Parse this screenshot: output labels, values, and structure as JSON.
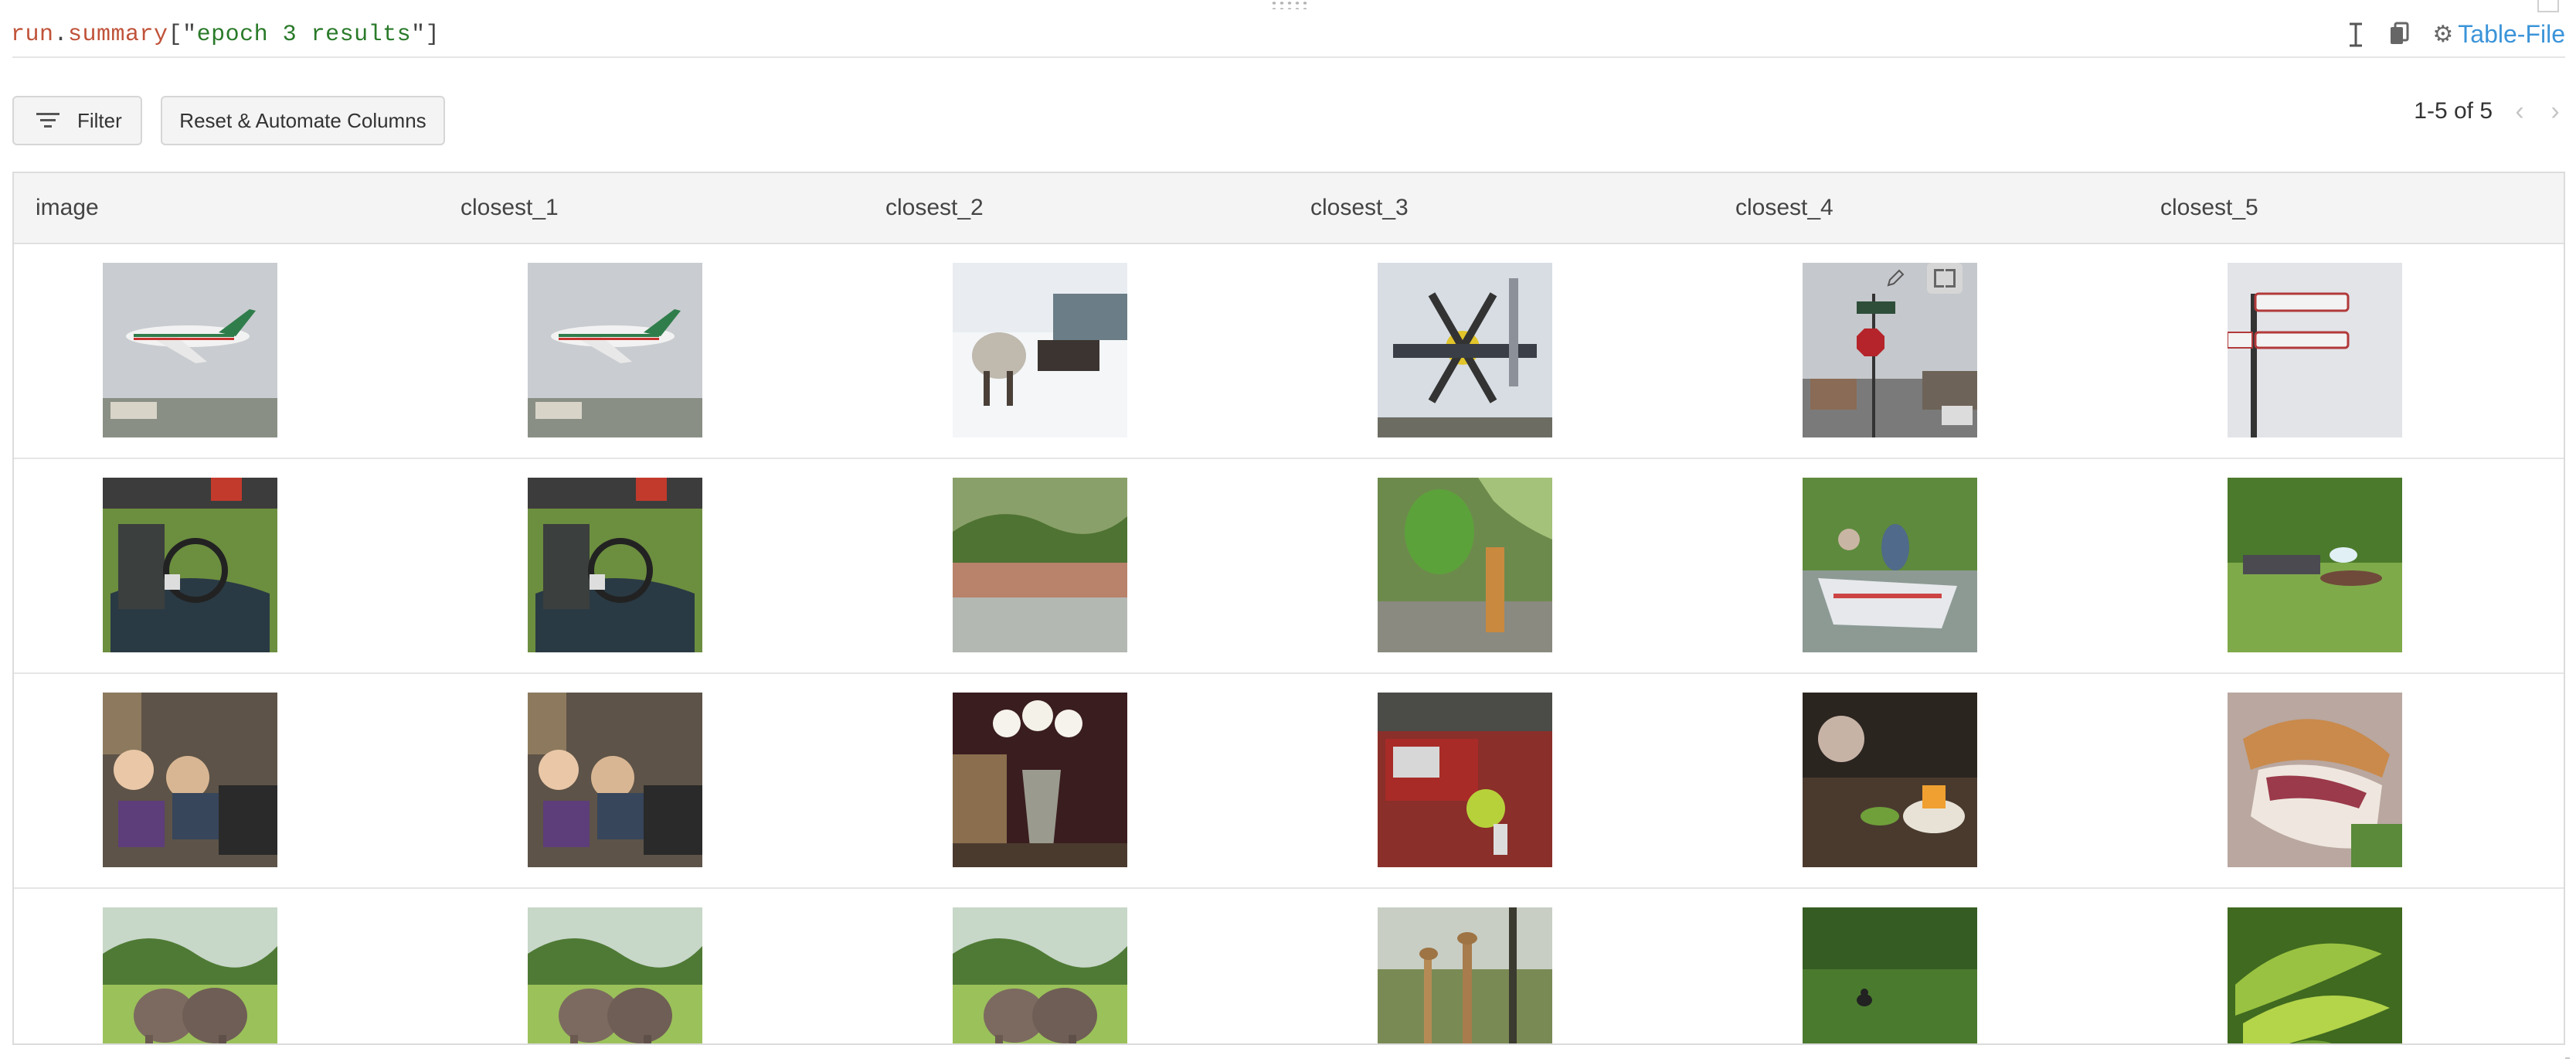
{
  "expression": {
    "obj": "run",
    "dot": ".",
    "attr": "summary",
    "open": "[\"",
    "key": "epoch 3 results",
    "close": "\"]"
  },
  "toolbar": {
    "type_label": "Table-File",
    "accent": "#3b94d9"
  },
  "controls": {
    "filter_label": "Filter",
    "reset_label": "Reset & Automate Columns"
  },
  "pagination": {
    "range_text": "1-5 of 5"
  },
  "table": {
    "columns": [
      "image",
      "closest_1",
      "closest_2",
      "closest_3",
      "closest_4",
      "closest_5"
    ],
    "rows": [
      [
        "airliner",
        "airliner",
        "horse-in-snow",
        "propeller-plane",
        "street-sign-stop",
        "street-sign-pole"
      ],
      [
        "vintage-race-car",
        "vintage-race-car",
        "river-palm-trees",
        "banana-bunch",
        "boat-in-stream",
        "people-on-grass"
      ],
      [
        "children-birthday",
        "children-birthday",
        "white-roses-vase",
        "red-fire-truck",
        "birthday-cake-candles",
        "sandwich-closeup"
      ],
      [
        "elephants",
        "elephants",
        "elephants",
        "giraffes",
        "small-animal-grass",
        "green-bananas"
      ]
    ]
  }
}
